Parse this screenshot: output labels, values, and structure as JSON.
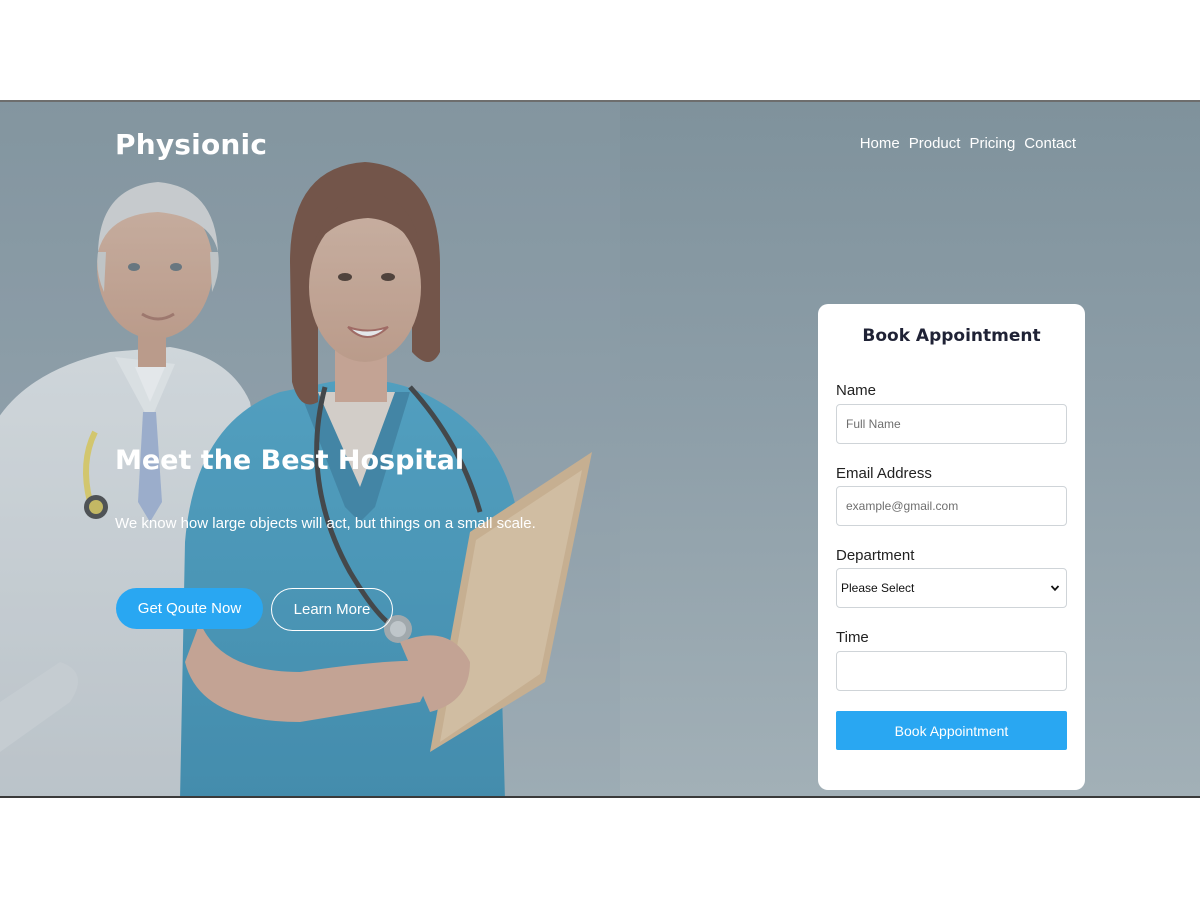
{
  "brand": {
    "name": "Physionic"
  },
  "nav": {
    "items": [
      {
        "label": "Home"
      },
      {
        "label": "Product"
      },
      {
        "label": "Pricing"
      },
      {
        "label": "Contact"
      }
    ]
  },
  "hero": {
    "title": "Meet the Best Hospital",
    "subtitle": "We know how large objects will act, but things on a small scale.",
    "primary_cta": "Get Qoute Now",
    "secondary_cta": "Learn More"
  },
  "appointment": {
    "title": "Book Appointment",
    "name": {
      "label": "Name",
      "placeholder": "Full Name",
      "value": ""
    },
    "email": {
      "label": "Email Address",
      "placeholder": "example@gmail.com",
      "value": ""
    },
    "department": {
      "label": "Department",
      "selected": "Please Select"
    },
    "time": {
      "label": "Time",
      "value": ""
    },
    "submit_label": "Book Appointment"
  },
  "colors": {
    "accent": "#29a7f2",
    "hero_background": "#8d9ea8",
    "card_background": "#ffffff",
    "heading_text": "#1f2235"
  },
  "icons": {
    "select_arrow": "chevron-down-icon"
  }
}
